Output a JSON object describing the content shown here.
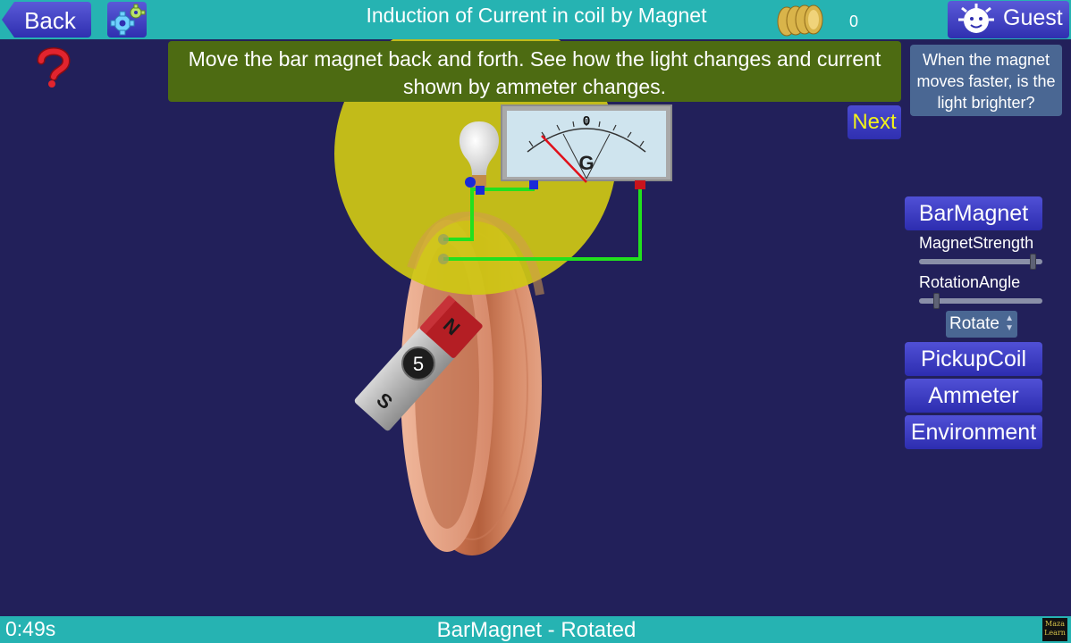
{
  "header": {
    "back_label": "Back",
    "title": "Induction of Current in coil by Magnet",
    "coins": "0",
    "user_label": "Guest"
  },
  "instruction": "Move the bar magnet back and forth. See how the light changes and current shown by ammeter changes.",
  "question": "When the magnet moves faster, is the light brighter?",
  "next_label": "Next",
  "scene": {
    "ammeter_zero": "0",
    "ammeter_letter": "G",
    "magnet_strength": "5",
    "magnet_pole_s": "S",
    "magnet_pole_n": "N"
  },
  "panel": {
    "bar_magnet": "BarMagnet",
    "magnet_strength_label": "MagnetStrength",
    "magnet_strength_level": 0.95,
    "rotation_angle_label": "RotationAngle",
    "rotation_angle_level": 0.12,
    "rotate_option": "Rotate",
    "pickup_coil": "PickupCoil",
    "ammeter": "Ammeter",
    "environment": "Environment"
  },
  "footer": {
    "timer": "0:49s",
    "status": "BarMagnet - Rotated",
    "logo": "Maza Learn"
  },
  "colors": {
    "topbar": "#26b3b2",
    "background": "#22205a",
    "instruction_bg": "#4d6b12",
    "button_blue": "#3a3ac4",
    "next_text": "#f2f21a",
    "glow": "#cfc714",
    "wire": "#22e01e"
  }
}
